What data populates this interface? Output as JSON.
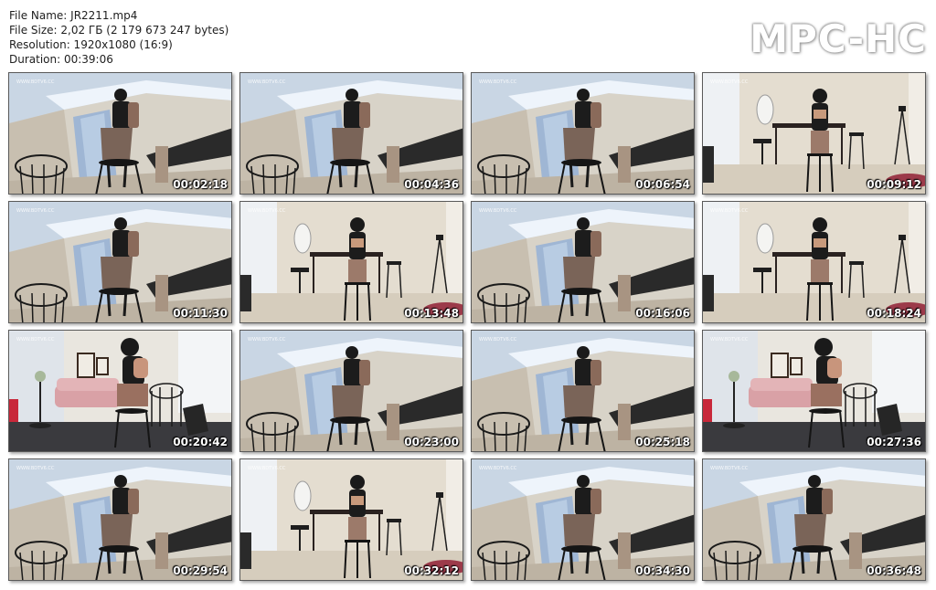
{
  "info": {
    "file_name": "File Name: JR2211.mp4",
    "file_size": "File Size: 2,02 ГБ (2 179 673 247 bytes)",
    "resolution": "Resolution: 1920x1080 (16:9)",
    "duration": "Duration: 00:39:06"
  },
  "brand": "MPC-HC",
  "watermark": "WWW.BDTV6.CC",
  "thumbnails": [
    {
      "scene": "a",
      "timestamp": "00:02:18"
    },
    {
      "scene": "a",
      "timestamp": "00:04:36"
    },
    {
      "scene": "a",
      "timestamp": "00:06:54"
    },
    {
      "scene": "b",
      "timestamp": "00:09:12"
    },
    {
      "scene": "a",
      "timestamp": "00:11:30"
    },
    {
      "scene": "b",
      "timestamp": "00:13:48"
    },
    {
      "scene": "a",
      "timestamp": "00:16:06"
    },
    {
      "scene": "b",
      "timestamp": "00:18:24"
    },
    {
      "scene": "c",
      "timestamp": "00:20:42"
    },
    {
      "scene": "a",
      "timestamp": "00:23:00"
    },
    {
      "scene": "a",
      "timestamp": "00:25:18"
    },
    {
      "scene": "c",
      "timestamp": "00:27:36"
    },
    {
      "scene": "a",
      "timestamp": "00:29:54"
    },
    {
      "scene": "b",
      "timestamp": "00:32:12"
    },
    {
      "scene": "a",
      "timestamp": "00:34:30"
    },
    {
      "scene": "a",
      "timestamp": "00:36:48"
    }
  ]
}
